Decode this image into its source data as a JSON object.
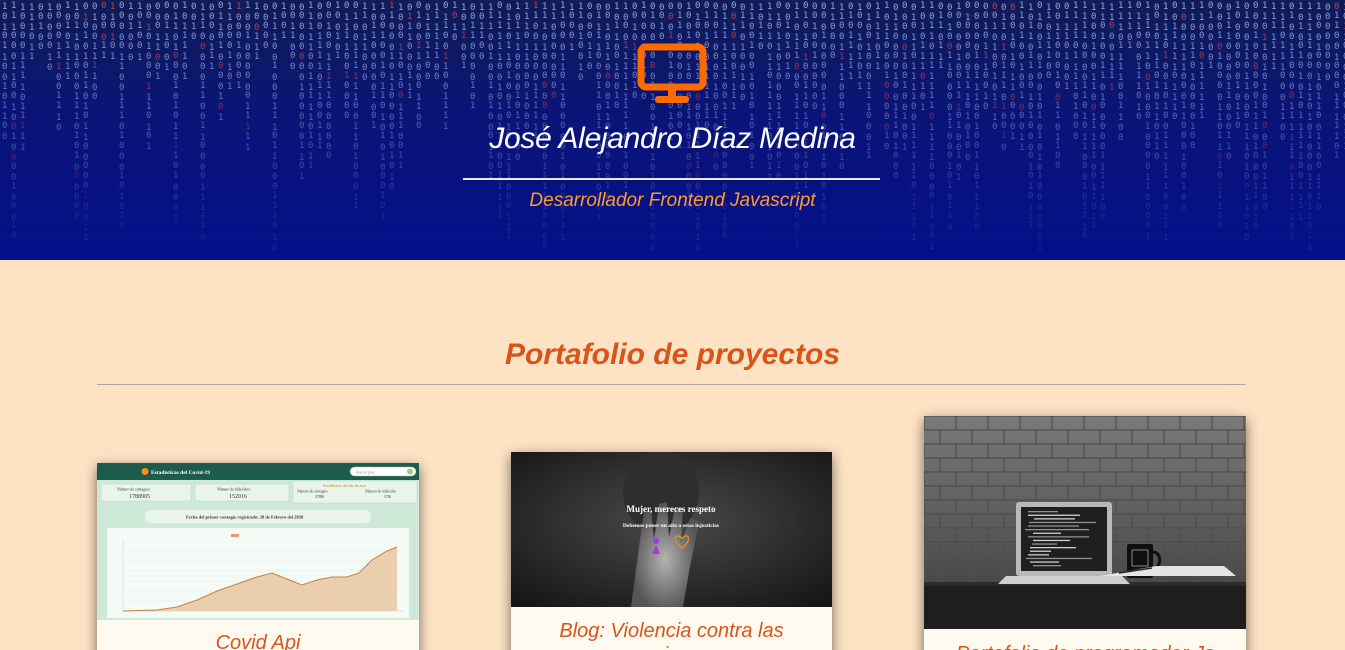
{
  "header": {
    "name": "José Alejandro Díaz Medina",
    "role": "Desarrollador Frontend Javascript",
    "icon": "monitor-icon",
    "accent_color": "#ff6a00"
  },
  "portfolio": {
    "title": "Portafolio de proyectos",
    "cards": [
      {
        "caption": "Covid Api",
        "preview": {
          "title": "Estadísticas del Covid-19",
          "search_placeholder": "Buscar país",
          "cases_label": "Número de contagios:",
          "cases_value": "1788905",
          "deaths_label": "Número de fallecidos:",
          "deaths_value": "152016",
          "yesterday_title": "Estadísticas del día de ayer",
          "yesterday_cases_label": "Número de contagios",
          "yesterday_cases_value": "27888",
          "yesterday_deaths_label": "Número de fallecidos",
          "yesterday_deaths_value": "1750",
          "first_case_text": "Fecha del primer contagio registrado: 28 de Febrero del 2020"
        }
      },
      {
        "caption": "Blog: Violencia contra las mujeres",
        "preview": {
          "headline": "Mujer, mereces respeto",
          "subline": "Debemos poner un alto a estas injusticias"
        }
      },
      {
        "caption": "Portafolio de programador Js"
      }
    ]
  }
}
